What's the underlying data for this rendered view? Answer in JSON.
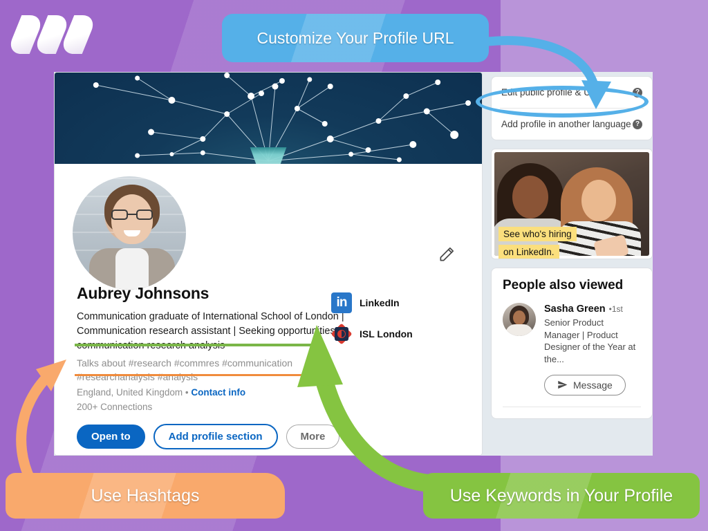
{
  "brand": {
    "logo_name": "three-slash-logo"
  },
  "callouts": {
    "top": "Customize Your Profile URL",
    "bottom_left": "Use Hashtags",
    "bottom_right": "Use Keywords in Your Profile"
  },
  "profile": {
    "name": "Aubrey Johnsons",
    "headline": "Communication graduate of International School of London | Communication research assistant | Seeking opportunities in communication research analysis",
    "talks_about": "Talks about #research #commres #communication #researchanalysis #analysis",
    "location": "England, United Kingdom",
    "location_separator": " • ",
    "contact_info": "Contact info",
    "connections": "200+ Connections",
    "edit_icon": "pencil-icon",
    "buttons": {
      "open_to": "Open to",
      "add_profile_section": "Add profile section",
      "more": "More"
    },
    "companies": [
      {
        "name": "LinkedIn",
        "icon": "linkedin-logo-icon"
      },
      {
        "name": "ISL London",
        "icon": "isl-london-logo-icon"
      }
    ]
  },
  "rail": {
    "menu": [
      {
        "label": "Edit public profile & URL",
        "help_icon": "help-circle-icon"
      },
      {
        "label": "Add profile in another language",
        "help_icon": "help-circle-icon"
      }
    ],
    "ad": {
      "line1": "See who's hiring",
      "line2": "on LinkedIn."
    },
    "people_also_viewed": {
      "title": "People also viewed",
      "person": {
        "name": "Sasha Green",
        "degree": "•1st",
        "description": "Senior Product Manager | Product Designer of the Year at the...",
        "message_button": "Message",
        "message_icon": "send-icon"
      }
    }
  },
  "colors": {
    "background_purple": "#9e68ca",
    "background_purple_light": "#b994d9",
    "callout_blue": "#55b0e8",
    "callout_orange": "#f9a96c",
    "callout_green": "#85c441",
    "linkedin_blue": "#0a66c2",
    "highlight_green": "#7ab648",
    "highlight_orange": "#f08b3c"
  }
}
